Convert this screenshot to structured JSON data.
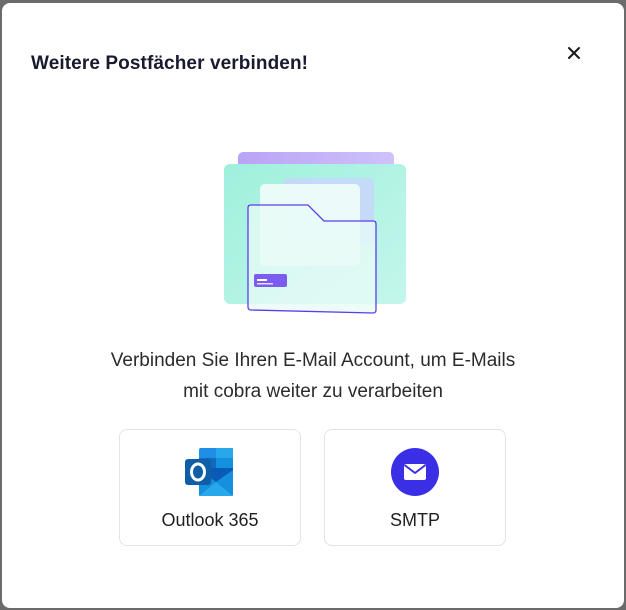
{
  "dialog": {
    "title": "Weitere Postfächer verbinden!",
    "close_icon": "close-icon",
    "illustration_icon": "folder-mail-illustration",
    "description_line1": "Verbinden Sie Ihren E-Mail Account, um E-Mails",
    "description_line2": "mit cobra weiter zu verarbeiten",
    "options": [
      {
        "label": "Outlook 365",
        "icon": "outlook-icon",
        "color": "#0f6cbd"
      },
      {
        "label": "SMTP",
        "icon": "envelope-icon",
        "color": "#3b2fe6"
      }
    ]
  },
  "colors": {
    "overlay": "#6b6b6b",
    "surface": "#ffffff",
    "accent_purple": "#3b2fe6",
    "illustration_mint": "#a8f0e0",
    "illustration_lavender": "#b9a6f5"
  }
}
